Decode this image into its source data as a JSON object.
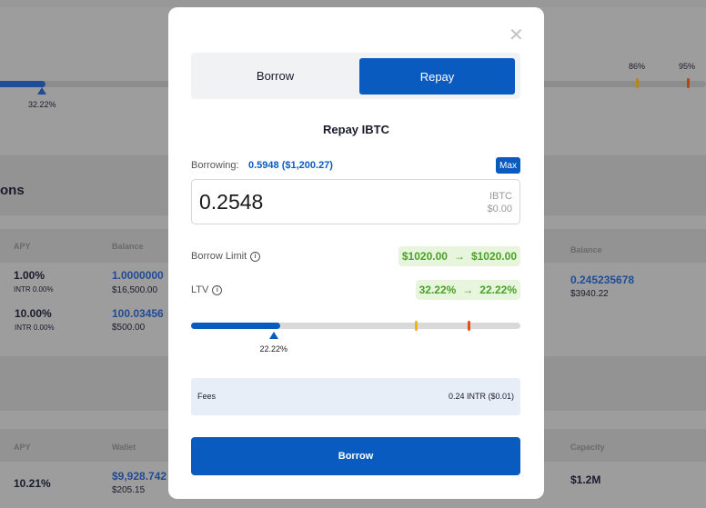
{
  "background": {
    "ltv_bar": {
      "current_label": "32.22%",
      "threshold_1": "86%",
      "threshold_2": "95%",
      "value_percent": 32.22
    },
    "section_title": "ons",
    "positions_table": {
      "headers": [
        "APY",
        "Balance",
        "Balance"
      ],
      "rows": [
        {
          "apy": "1.00%",
          "apy_sub": "INTR 0.00%",
          "balance": "1.0000000",
          "balance_usd": "$16,500.00"
        },
        {
          "apy": "10.00%",
          "apy_sub": "INTR 0.00%",
          "balance": "100.03456",
          "balance_usd": "$500.00"
        }
      ],
      "right_balance": "0.245235678",
      "right_balance_usd": "$3940.22"
    },
    "markets_table": {
      "headers": [
        "APY",
        "Wallet",
        "Capacity"
      ],
      "rows": [
        {
          "apy": "10.21%",
          "wallet": "$9,928.742",
          "wallet_usd": "$205.15",
          "capacity": "$1.2M"
        }
      ]
    }
  },
  "modal": {
    "tabs": [
      {
        "label": "Borrow",
        "active": false
      },
      {
        "label": "Repay",
        "active": true
      }
    ],
    "title": "Repay IBTC",
    "borrowing_label": "Borrowing:",
    "borrowing_value": "0.5948 ($1,200.27)",
    "max_label": "Max",
    "amount_value": "0.2548",
    "token": "IBTC",
    "amount_usd": "$0.00",
    "borrow_limit": {
      "label": "Borrow Limit",
      "from": "$1020.00",
      "arrow": "→",
      "to": "$1020.00"
    },
    "ltv": {
      "label": "LTV",
      "from": "32.22%",
      "arrow": "→",
      "to": "22.22%"
    },
    "ltv_bar": {
      "value_percent": 22.22,
      "label": "22.22%",
      "warn_percent": 68,
      "danger_percent": 84
    },
    "fees_label": "Fees",
    "fees_value": "0.24 INTR ($0.01)",
    "submit_label": "Borrow"
  },
  "colors": {
    "accent": "#0a5bc0",
    "green_bg": "#e6f5dc",
    "green_text": "#4ba02a",
    "warn": "#f5b400",
    "danger": "#f04a14"
  }
}
